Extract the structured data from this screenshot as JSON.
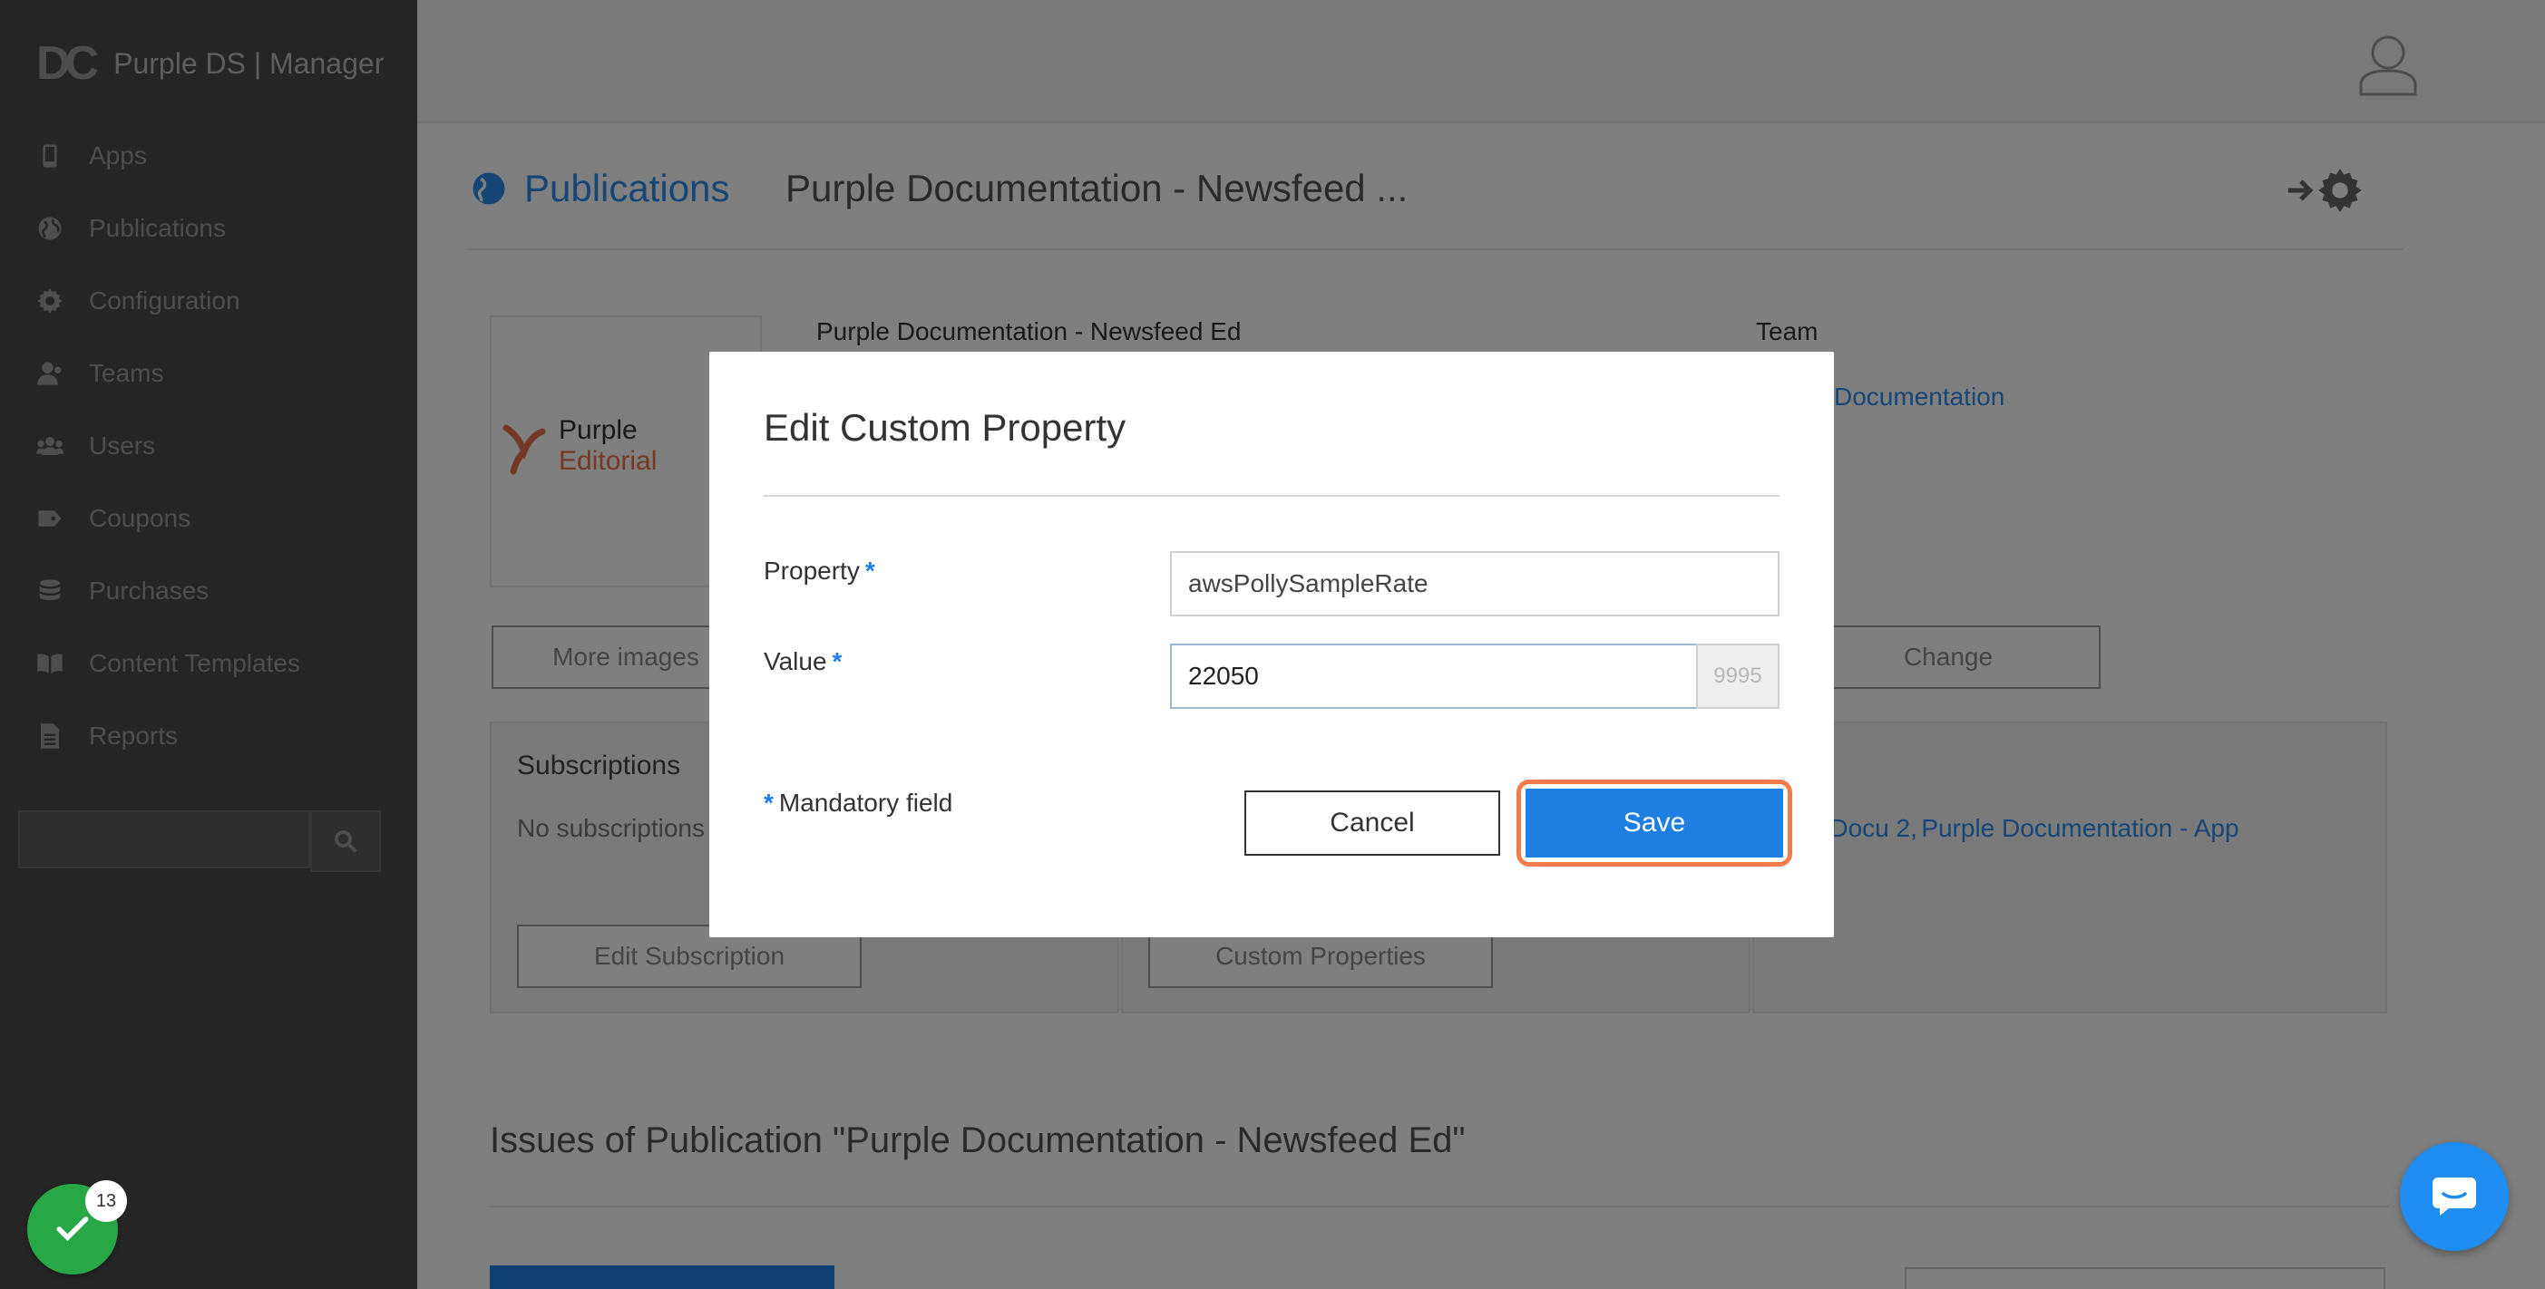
{
  "app": {
    "logo_mark": "DC",
    "title": "Purple DS | Manager"
  },
  "sidebar": {
    "items": [
      {
        "label": "Apps",
        "icon": "phone-icon"
      },
      {
        "label": "Publications",
        "icon": "globe-icon"
      },
      {
        "label": "Configuration",
        "icon": "gear-icon"
      },
      {
        "label": "Teams",
        "icon": "team-icon"
      },
      {
        "label": "Users",
        "icon": "users-icon"
      },
      {
        "label": "Coupons",
        "icon": "tag-icon"
      },
      {
        "label": "Purchases",
        "icon": "database-icon"
      },
      {
        "label": "Content Templates",
        "icon": "book-icon"
      },
      {
        "label": "Reports",
        "icon": "file-icon"
      }
    ],
    "search_placeholder": ""
  },
  "header": {
    "breadcrumb": "Publications",
    "title": "Purple Documentation - Newsfeed ..."
  },
  "publication": {
    "name": "Purple Documentation - Newsfeed Ed",
    "logo_line1": "Purple",
    "logo_line2": "Editorial",
    "team_label": "Team",
    "team_value": "Documentation",
    "more_images": "More images",
    "change": "Change",
    "subscriptions_title": "Subscriptions",
    "no_subscriptions": "No subscriptions",
    "edit_subscription": "Edit Subscription",
    "custom_properties": "Custom Properties",
    "links_text1": "e Docu 2,",
    "links_text2": "Purple Documentation - App",
    "issues_title": "Issues of Publication \"Purple Documentation - Newsfeed Ed\""
  },
  "modal": {
    "title": "Edit Custom Property",
    "property_label": "Property",
    "property_value": "awsPollySampleRate",
    "value_label": "Value",
    "value_value": "22050",
    "value_counter": "9995",
    "required_marker": "*",
    "mandatory_note": "Mandatory field",
    "cancel_label": "Cancel",
    "save_label": "Save"
  },
  "notifications": {
    "count": "13"
  },
  "colors": {
    "accent": "#1e7fe0",
    "highlight": "#f27b4b",
    "success": "#27a745",
    "sidebar": "#4b4b4b"
  }
}
